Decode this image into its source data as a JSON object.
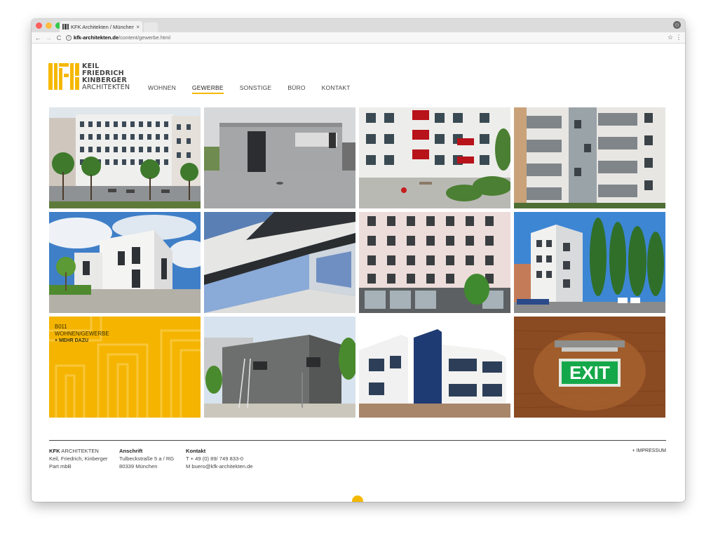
{
  "browser": {
    "tab_title": "KFK Architekten / München / K",
    "tab_close": "×",
    "url_domain": "kfk-architekten.de",
    "url_path": "/content/gewerbe.html",
    "back": "←",
    "forward": "→",
    "reload": "C",
    "star": "☆",
    "menu": "⋮",
    "profile": "⚇",
    "colors": {
      "close": "#fc605c",
      "minimize": "#fdbc40",
      "maximize": "#34c84a"
    }
  },
  "logo": {
    "lines": [
      "KEIL",
      "FRIEDRICH",
      "KINBERGER",
      "ARCHITEKTEN"
    ],
    "accent": "#f5b800"
  },
  "nav": {
    "items": [
      "WOHNEN",
      "GEWERBE",
      "SONSTIGE",
      "BÜRO",
      "KONTAKT"
    ],
    "active": "GEWERBE"
  },
  "tiles": [
    {
      "id": "B011",
      "caption": "WOHNEN/GEWERBE",
      "more": "+ MEHR DAZU"
    }
  ],
  "footer": {
    "col1_brand": "KFK",
    "col1_brand_rest": " ARCHITEKTEN",
    "col1_line2": "Keil, Friedrich, Kinberger",
    "col1_line3": "Part mbB",
    "col2_title": "Anschrift",
    "col2_line2": "Tulbeckstraße 5 a / RG",
    "col2_line3": "80339 München",
    "col3_title": "Kontakt",
    "col3_line2": "T + 49 (0) 89/ 749 833-0",
    "col3_line3": "M buero@kfk-architekten.de",
    "impressum": "+ IMPRESSUM"
  }
}
